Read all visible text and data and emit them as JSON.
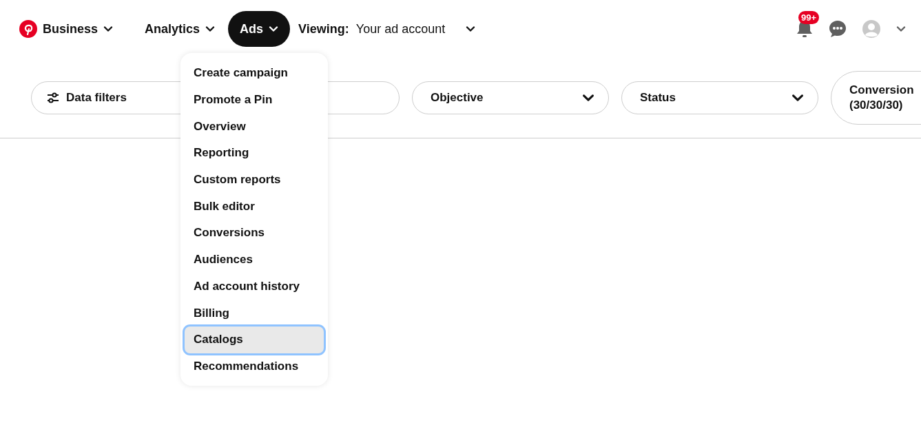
{
  "nav": {
    "items": [
      {
        "label": "Business",
        "kind": "logo",
        "selected": false
      },
      {
        "label": "Analytics",
        "kind": "plain",
        "selected": false
      },
      {
        "label": "Ads",
        "kind": "plain",
        "selected": true
      }
    ],
    "viewing": {
      "label": "Viewing:",
      "value": "Your ad account"
    },
    "notifications": {
      "badge": "99+"
    }
  },
  "menu": {
    "items": [
      {
        "label": "Create campaign",
        "selected": false
      },
      {
        "label": "Promote a Pin",
        "selected": false
      },
      {
        "label": "Overview",
        "selected": false
      },
      {
        "label": "Reporting",
        "selected": false
      },
      {
        "label": "Custom reports",
        "selected": false
      },
      {
        "label": "Bulk editor",
        "selected": false
      },
      {
        "label": "Conversions",
        "selected": false
      },
      {
        "label": "Audiences",
        "selected": false
      },
      {
        "label": "Ad account history",
        "selected": false
      },
      {
        "label": "Billing",
        "selected": false
      },
      {
        "label": "Catalogs",
        "selected": true
      },
      {
        "label": "Recommendations",
        "selected": false
      }
    ]
  },
  "filters": [
    {
      "kind": "filters",
      "lines": [
        "Data filters"
      ]
    },
    {
      "kind": "dropdown",
      "lines": [
        "Objective"
      ]
    },
    {
      "kind": "dropdown",
      "lines": [
        "Status"
      ]
    },
    {
      "kind": "tall",
      "lines": [
        "Conversion",
        "(30/30/30)"
      ]
    }
  ]
}
